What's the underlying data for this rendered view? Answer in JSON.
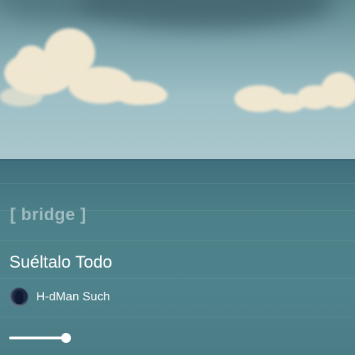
{
  "section_tag": "[ bridge ]",
  "song": {
    "title": "Suéltalo Todo",
    "artist": "H-dMan Such"
  },
  "playback": {
    "progress": 1.0
  },
  "colors": {
    "text_primary": "#ffffff",
    "section_tag": "#e1ebee"
  },
  "icons": {
    "avatar": "artist-avatar"
  }
}
